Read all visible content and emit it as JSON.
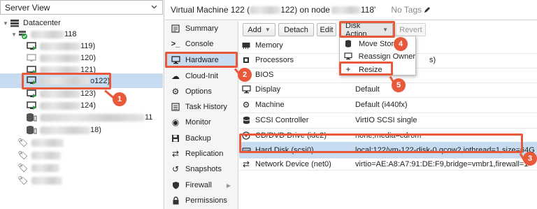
{
  "server_view": {
    "label": "Server View"
  },
  "tree": {
    "datacenter": "Datacenter",
    "node_suffix": "118",
    "vms": [
      {
        "suffix": "119)"
      },
      {
        "suffix": "120)"
      },
      {
        "suffix": "121)"
      },
      {
        "suffix": "o122)"
      },
      {
        "suffix": "123)"
      },
      {
        "suffix": "124)"
      },
      {
        "suffix": "11"
      },
      {
        "suffix": "18)"
      }
    ]
  },
  "header": {
    "title_prefix": "Virtual Machine 122 (",
    "title_mid": "122) on node ",
    "title_end": "118'",
    "tags": "No Tags"
  },
  "nav": {
    "items": [
      {
        "label": "Summary"
      },
      {
        "label": "Console"
      },
      {
        "label": "Hardware"
      },
      {
        "label": "Cloud-Init"
      },
      {
        "label": "Options"
      },
      {
        "label": "Task History"
      },
      {
        "label": "Monitor"
      },
      {
        "label": "Backup"
      },
      {
        "label": "Replication"
      },
      {
        "label": "Snapshots"
      },
      {
        "label": "Firewall"
      },
      {
        "label": "Permissions"
      }
    ]
  },
  "toolbar": {
    "add": "Add",
    "detach": "Detach",
    "edit": "Edit",
    "disk_action": "Disk Action",
    "revert": "Revert"
  },
  "hardware": {
    "rows": [
      {
        "name": "Memory",
        "value": ""
      },
      {
        "name": "Processors",
        "value": "s)"
      },
      {
        "name": "BIOS",
        "value": ""
      },
      {
        "name": "Display",
        "value": "Default"
      },
      {
        "name": "Machine",
        "value": "Default (i440fx)"
      },
      {
        "name": "SCSI Controller",
        "value": "VirtIO SCSI single"
      },
      {
        "name": "CD/DVD Drive (ide2)",
        "value": "none,media=cdrom"
      },
      {
        "name": "Hard Disk (scsi0)",
        "value": "local:122/vm-122-disk-0.qcow2,iothread=1,size=64G"
      },
      {
        "name": "Network Device (net0)",
        "value": "virtio=AE:A8:A7:91:DE:F9,bridge=vmbr1,firewall=1"
      }
    ]
  },
  "menu": {
    "move_storage": "Move Stora",
    "reassign_owner": "Reassign Owner",
    "resize": "Resize"
  },
  "annotations": {
    "b1": "1",
    "b2": "2",
    "b3": "3",
    "b4": "4",
    "b5": "5"
  },
  "colors": {
    "accent": "#e8583a",
    "selected": "#c7dcf1",
    "nav_bg": "#f5f5f5"
  }
}
